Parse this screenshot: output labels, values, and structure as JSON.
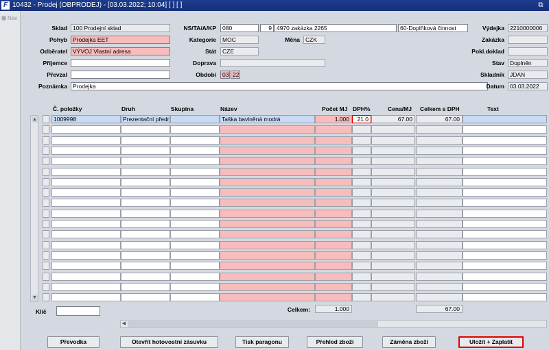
{
  "window": {
    "title": "10432 - Prodej (OBPRODEJ) - [03.03.2022; 10:04]  [ ]  [ ]"
  },
  "nav": {
    "label": "Nav"
  },
  "header": {
    "sklad": {
      "label": "Sklad",
      "value": "100 Prodejní sklad"
    },
    "pohyb": {
      "label": "Pohyb",
      "value": "Prodejka EET"
    },
    "odberatel": {
      "label": "Odběratel",
      "value": "VÝVOJ Vlastní adresa"
    },
    "prijemce": {
      "label": "Příjemce",
      "value": ""
    },
    "prevzal": {
      "label": "Převzal",
      "value": ""
    },
    "poznamka": {
      "label": "Poznámka",
      "value": "Prodejka"
    },
    "nstakp": {
      "label": "NS/TA/A/KP",
      "v1": "080",
      "v2": "9",
      "v3": "4970 zakázka 2265",
      "v4": "60-Doplňková činnost"
    },
    "kategorie": {
      "label": "Kategorie",
      "value": "MOC"
    },
    "mena": {
      "label": "Měna",
      "value": "CZK"
    },
    "stat": {
      "label": "Stát",
      "value": "CZE"
    },
    "doprava": {
      "label": "Doprava",
      "value": ""
    },
    "obdobi": {
      "label": "Období",
      "v1": "03",
      "v2": "22"
    },
    "vydejka": {
      "label": "Výdejka",
      "value": "2210000006"
    },
    "zakazka": {
      "label": "Zakázka",
      "value": ""
    },
    "pokldoklad": {
      "label": "Pokl.doklad",
      "value": ""
    },
    "stav": {
      "label": "Stav",
      "value": "Doplněn"
    },
    "skladnik": {
      "label": "Skladník",
      "value": "JDAN"
    },
    "datum": {
      "label": "Datum",
      "value": "03.03.2022"
    }
  },
  "grid": {
    "columns": [
      "Č. položky",
      "Druh",
      "Skupina",
      "Název",
      "Počet MJ",
      "DPH%",
      "Cena/MJ",
      "Celkem s DPH",
      "Text"
    ],
    "rows": [
      {
        "cislo": "1009998",
        "druh": "Prezentační předr",
        "skupina": "",
        "nazev": "Taška bavlněná modrá",
        "pocet": "1.000",
        "dph": "21.0",
        "cena": "67.00",
        "celkem": "67.00",
        "text": ""
      }
    ]
  },
  "footer": {
    "klic_label": "Klíč",
    "klic_value": "",
    "celkem_label": "Celkem:",
    "celkem_pocet": "1.000",
    "celkem_suma": "67.00"
  },
  "buttons": {
    "prevodka": "Převodka",
    "zasuvka": "Otevřít hotovostní zásuvku",
    "paragon": "Tisk paragonu",
    "prehled": "Přehled zboží",
    "zamena": "Záměna zboží",
    "ulozit": "Uložit + Zaplatit"
  },
  "colors": {
    "titlebar": "#1d3d8f",
    "required": "#f7bcbc",
    "highlight": "#e00000"
  }
}
